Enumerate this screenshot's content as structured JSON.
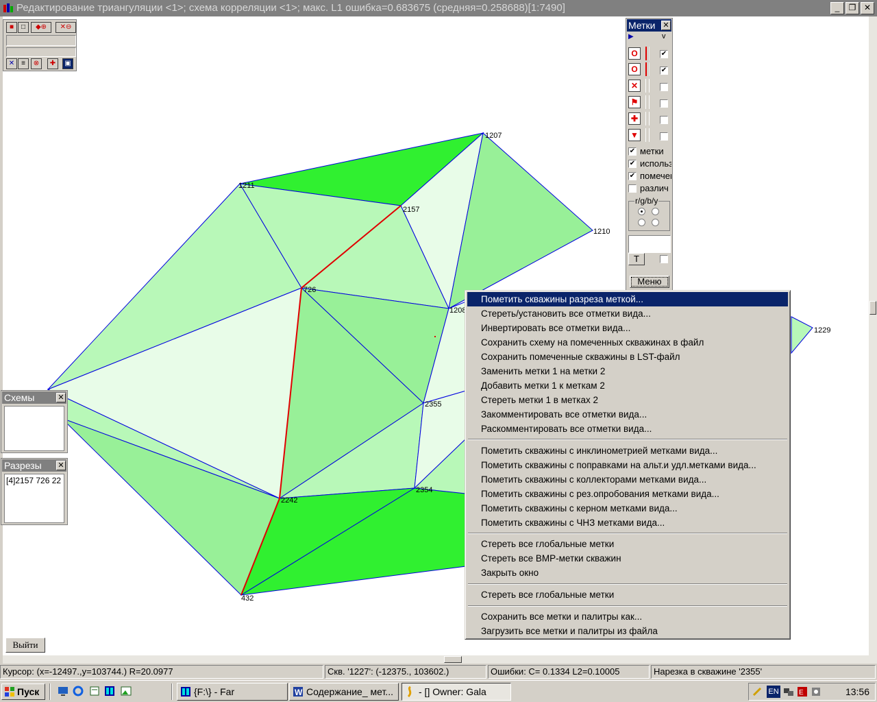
{
  "window": {
    "title": "Редактирование триангуляции <1>; схема корреляции <1>; макс. L1 ошибка=0.683675 (средняя=0.258688)[1:7490]",
    "controls": [
      "_",
      "❐",
      "✕"
    ]
  },
  "map": {
    "well_labels": {
      "w1207": "1207",
      "w1211": "1211",
      "w2157": "2157",
      "w1210": "1210",
      "w726": "726",
      "w1208": "1208",
      "w1229": "1229",
      "w2355": "2355",
      "w2354": "2354",
      "w2242": "2242",
      "w432": "432"
    },
    "colors": {
      "light": "#e8fce8",
      "medium": "#b8f8b8",
      "mid": "#98f098",
      "dark": "#30f030",
      "edge": "#0000e0",
      "section_line": "#e00000"
    }
  },
  "metki_panel": {
    "title": "Метки",
    "close": "✕",
    "dropdown_arrow": "v",
    "icons": [
      "circle-red-icon",
      "circle-red-icon",
      "cross-red-icon",
      "flag-red-icon",
      "plus-red-icon",
      "triangle-red-icon"
    ],
    "rows_checked": [
      true,
      true,
      false,
      false,
      false,
      false
    ],
    "options": [
      {
        "label": "метки",
        "checked": true
      },
      {
        "label": "использ",
        "checked": true
      },
      {
        "label": "помечен",
        "checked": true
      },
      {
        "label": "различ",
        "checked": false
      }
    ],
    "rgb_group_label": "r/g/b/y",
    "t_button": "T",
    "menu_button": "Меню"
  },
  "schemes_panel": {
    "title": "Схемы",
    "close": "✕"
  },
  "sections_panel": {
    "title": "Разрезы",
    "close": "✕",
    "items": [
      "[4]2157 726 22"
    ]
  },
  "exit_button": "Выйти",
  "context_menu": {
    "groups": [
      [
        "Пометить скважины разреза меткой...",
        "Стереть/установить все отметки вида...",
        "Инвертировать все отметки вида...",
        "Сохранить схему на помеченных скважинах в файл",
        "Сохранить помеченные скважины в LST-файл",
        "Заменить метки 1 на метки 2",
        "Добавить метки 1 к меткам 2",
        "Стереть метки 1 в метках 2",
        "Закомментировать все отметки вида...",
        "Раскомментировать все отметки вида..."
      ],
      [
        "Пометить скважины с инклинометрией метками вида...",
        "Пометить скважины с поправками на альт.и удл.метками вида...",
        "Пометить скважины с коллекторами метками вида...",
        "Пометить скважины с рез.опробования метками вида...",
        "Пометить скважины с керном метками вида...",
        "Пометить скважины с ЧНЗ метками вида..."
      ],
      [
        "Стереть все глобальные метки",
        "Стереть все BMP-метки скважин",
        "Закрыть окно"
      ],
      [
        "Стереть все глобальные метки"
      ],
      [
        "Сохранить все метки и палитры как...",
        "Загрузить все метки и палитры из файла"
      ]
    ]
  },
  "status_bar": {
    "cursor": "Курсор: (x=-12497.,y=103744.) R=20.0977",
    "well": "Скв. '1227': (-12375., 103602.)",
    "errors": "Ошибки: C=  0.1334 L2=0.10005",
    "cut": "Нарезка в скважине '2355'"
  },
  "taskbar": {
    "start": "Пуск",
    "tasks": [
      {
        "label": "{F:\\} - Far",
        "icon": "far-icon"
      },
      {
        "label": "Содержание_ мет...",
        "icon": "word-icon"
      },
      {
        "label": "- [] Owner: Gala",
        "icon": "app-icon"
      }
    ],
    "tray_lang": "EN",
    "clock": "13:56"
  }
}
